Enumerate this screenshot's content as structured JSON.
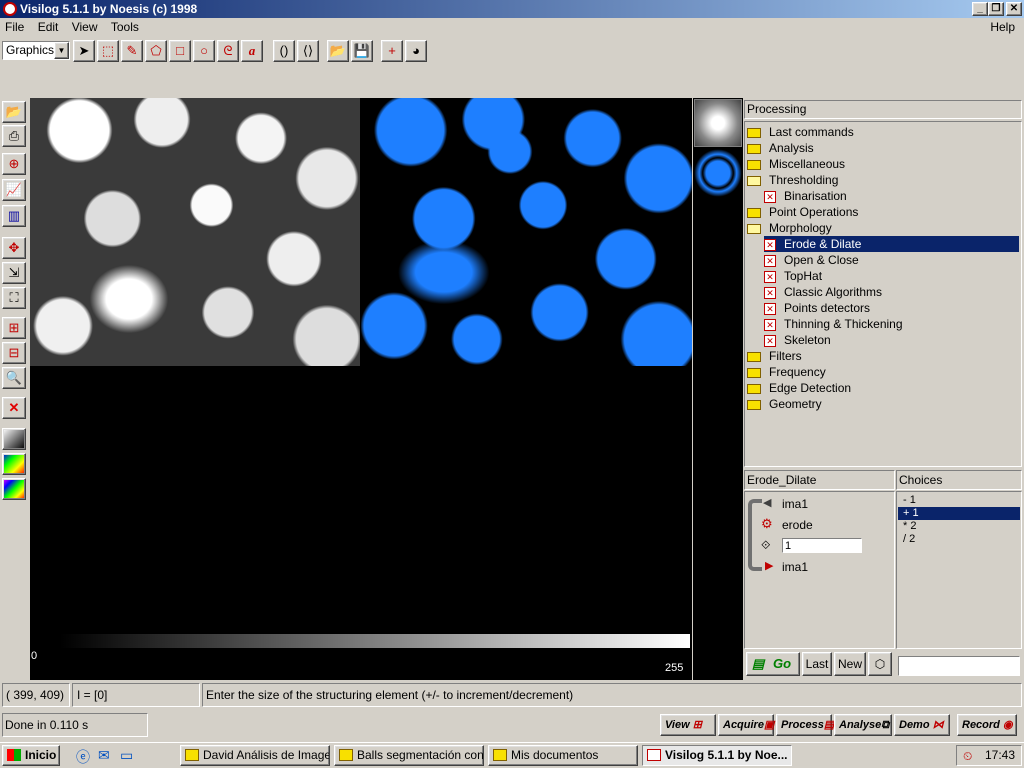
{
  "window": {
    "title": "Visilog 5.1.1 by Noesis (c) 1998"
  },
  "menu": {
    "file": "File",
    "edit": "Edit",
    "view": "View",
    "tools": "Tools",
    "help": "Help"
  },
  "toolbar": {
    "mode_select": "Graphics"
  },
  "panel": {
    "header": "Processing"
  },
  "tree": [
    {
      "label": "Last commands",
      "type": "folder"
    },
    {
      "label": "Analysis",
      "type": "folder"
    },
    {
      "label": "Miscellaneous",
      "type": "folder"
    },
    {
      "label": "Thresholding",
      "type": "folder-open"
    },
    {
      "label": "Binarisation",
      "type": "op"
    },
    {
      "label": "Point Operations",
      "type": "folder"
    },
    {
      "label": "Morphology",
      "type": "folder-open"
    },
    {
      "label": "Erode & Dilate",
      "type": "op",
      "selected": true
    },
    {
      "label": "Open & Close",
      "type": "op"
    },
    {
      "label": "TopHat",
      "type": "op"
    },
    {
      "label": "Classic Algorithms",
      "type": "op"
    },
    {
      "label": "Points detectors",
      "type": "op"
    },
    {
      "label": "Thinning & Thickening",
      "type": "op"
    },
    {
      "label": "Skeleton",
      "type": "op"
    },
    {
      "label": "Filters",
      "type": "folder"
    },
    {
      "label": "Frequency",
      "type": "folder"
    },
    {
      "label": "Edge Detection",
      "type": "folder"
    },
    {
      "label": "Geometry",
      "type": "folder"
    }
  ],
  "params": {
    "header": "Erode_Dilate",
    "input": "ima1",
    "operation": "erode",
    "size_value": "1",
    "output": "ima1"
  },
  "choices": {
    "header": "Choices",
    "items": [
      "- 1",
      "+ 1",
      "* 2",
      "/ 2"
    ],
    "selected_index": 1
  },
  "actions": {
    "go": "Go",
    "last": "Last",
    "new": "New"
  },
  "lut": {
    "min": "0",
    "max": "255"
  },
  "status": {
    "coords": "( 399, 409)",
    "intensity": "I = [0]",
    "message": "Enter the size of the structuring element (+/- to increment/decrement)",
    "done": "Done in 0.110 s"
  },
  "bottom_buttons": {
    "view": "View",
    "acquire": "Acquire",
    "process": "Process",
    "analyse": "Analyse",
    "demo": "Demo",
    "record": "Record"
  },
  "taskbar": {
    "start": "Inicio",
    "tasks": [
      "David Análisis de Imagen",
      "Balls segmentación con ...",
      "Mis documentos",
      "Visilog 5.1.1 by Noe..."
    ],
    "clock": "17:43"
  },
  "colors": {
    "title_bar": "#0a246a",
    "selection": "#0a246a",
    "binary_blue": "#1e7fff",
    "canvas": "#000000"
  }
}
